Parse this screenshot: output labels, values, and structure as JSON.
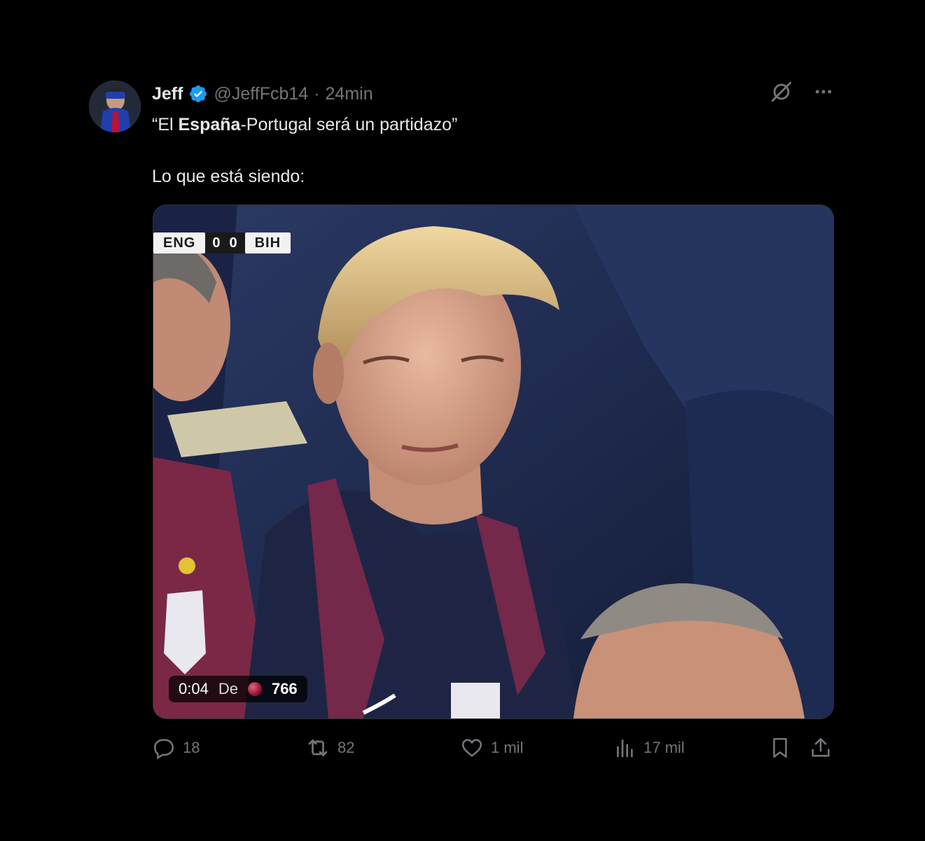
{
  "tweet": {
    "author": {
      "name": "Jeff",
      "handle": "@JeffFcb14",
      "separator": "·",
      "time": "24min",
      "verified": true
    },
    "text": {
      "line1_pre": "“El ",
      "line1_bold": "España",
      "line1_post": "-Portugal será un partidazo”",
      "line2": "Lo que está siendo:"
    },
    "top_icons": [
      "grok-icon",
      "more-icon"
    ],
    "media": {
      "type": "video",
      "scoreboard": {
        "home": "ENG",
        "home_score": "0",
        "away_score": "0",
        "away": "BIH"
      },
      "overlay": {
        "time": "0:04",
        "from_label": "De",
        "views": "766"
      }
    },
    "actions": {
      "replies": "18",
      "reposts": "82",
      "likes": "1 mil",
      "views": "17 mil"
    }
  },
  "colors": {
    "background": "#000000",
    "text": "#e7e9ea",
    "muted": "#71767b",
    "verified": "#1d9bf0",
    "border": "#2f3336"
  }
}
